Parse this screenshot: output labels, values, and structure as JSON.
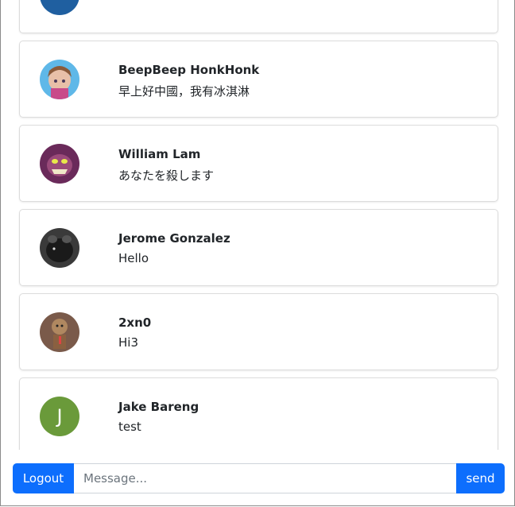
{
  "messages": [
    {
      "name": "",
      "text": "",
      "avatar": "blue-avatar-icon",
      "color": "#1f5fa0"
    },
    {
      "name": "BeepBeep HonkHonk",
      "text": "早上好中國，我有冰淇淋",
      "avatar": "anime-girl-avatar-icon",
      "color": "#5fb8e8"
    },
    {
      "name": "William Lam",
      "text": "あなたを殺します",
      "avatar": "monster-avatar-icon",
      "color": "#7a3a6a"
    },
    {
      "name": "Jerome Gonzalez",
      "text": "Hello",
      "avatar": "dark-animal-avatar-icon",
      "color": "#2a2a2a"
    },
    {
      "name": "2xn0",
      "text": "Hi3",
      "avatar": "sackboy-avatar-icon",
      "color": "#6a4a3a"
    },
    {
      "name": "Jake Bareng",
      "text": "test",
      "avatar_letter": "J",
      "color": "#6a9a3a"
    }
  ],
  "composer": {
    "logout_label": "Logout",
    "placeholder": "Message...",
    "send_label": "send"
  },
  "colors": {
    "primary": "#0d6efd"
  }
}
